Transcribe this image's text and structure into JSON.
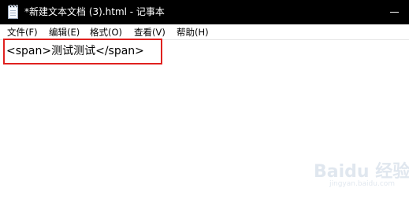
{
  "window": {
    "title": "*新建文本文档 (3).html - 记事本"
  },
  "menu": {
    "items": [
      {
        "label": "文件(F)"
      },
      {
        "label": "编辑(E)"
      },
      {
        "label": "格式(O)"
      },
      {
        "label": "查看(V)"
      },
      {
        "label": "帮助(H)"
      }
    ]
  },
  "editor": {
    "lines": [
      "<span>测试测试</span>"
    ]
  },
  "annotation": {
    "box_color": "#e0211f"
  },
  "watermark": {
    "brand": "Baidu 经验",
    "url": "jingyan.baidu.com"
  },
  "icons": {
    "app": "notepad-icon",
    "minimize": "minimize-icon"
  }
}
